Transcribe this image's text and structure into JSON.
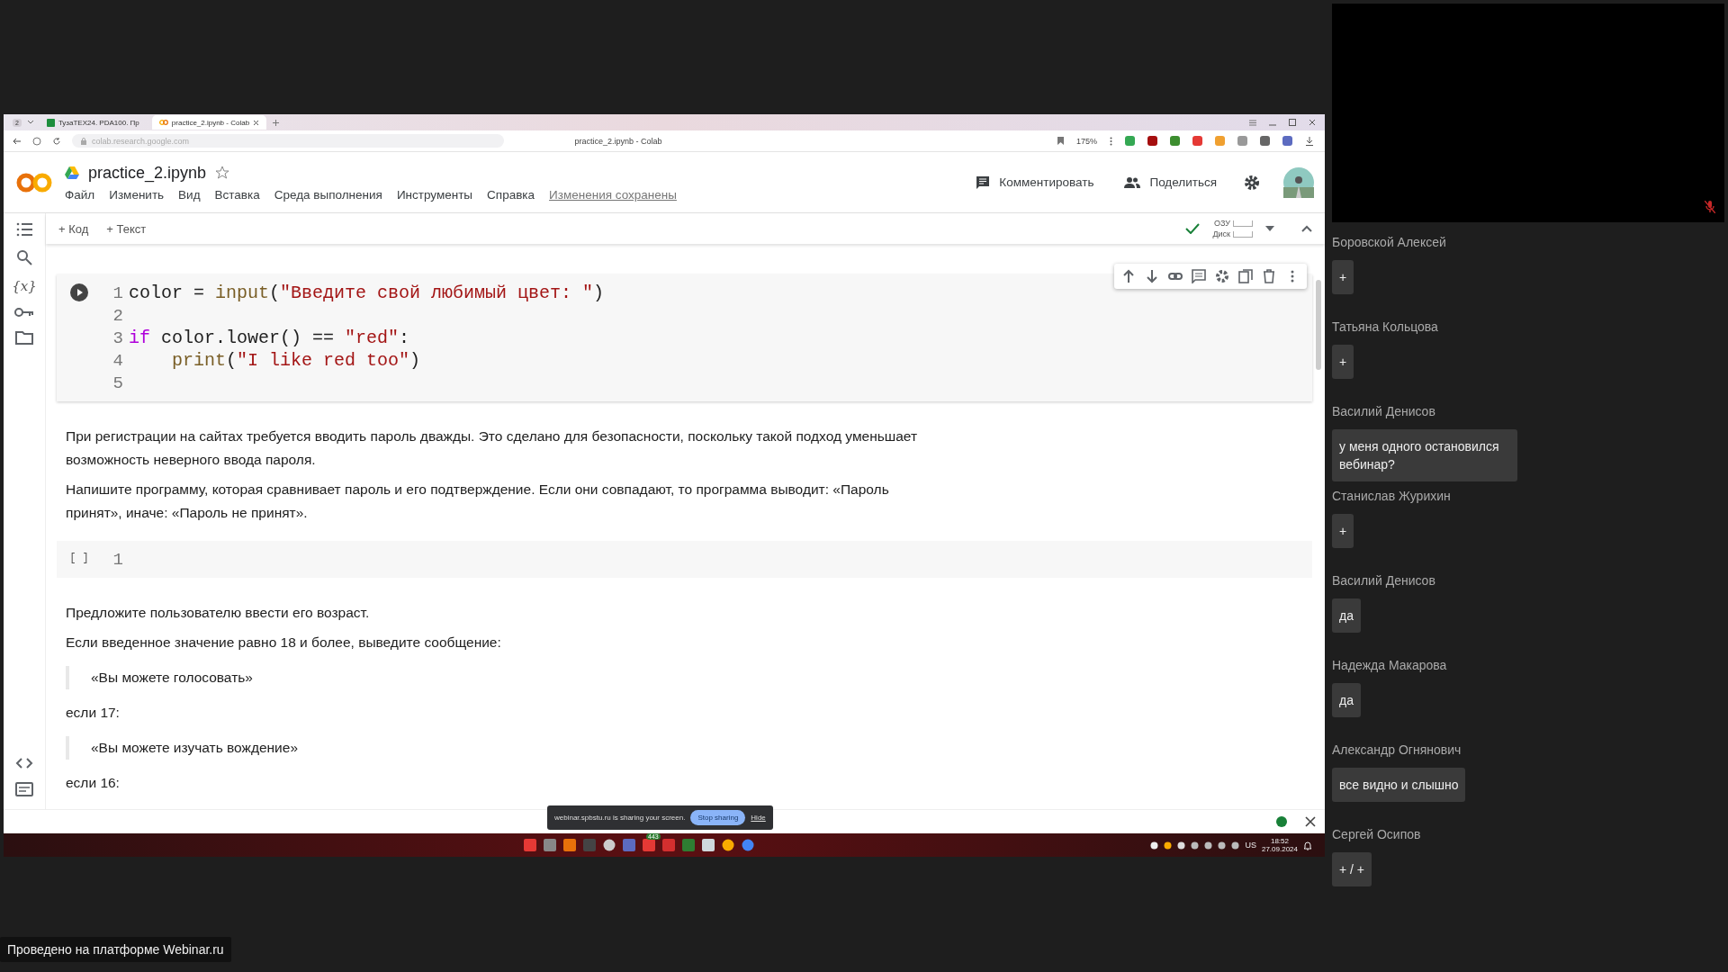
{
  "browser": {
    "tab_count": "2",
    "tabs": [
      {
        "label": "TyзaTEX24. PDA100. Пр",
        "selected": false
      },
      {
        "label": "practice_2.ipynb - Colab",
        "selected": true
      }
    ],
    "url": "colab.research.google.com",
    "page_title": "practice_2.ipynb - Colab",
    "zoom": "175%"
  },
  "colab": {
    "file_name": "practice_2.ipynb",
    "menu": [
      "Файл",
      "Изменить",
      "Вид",
      "Вставка",
      "Среда выполнения",
      "Инструменты",
      "Справка"
    ],
    "save_status": "Изменения сохранены",
    "comment": "Комментировать",
    "share": "Поделиться",
    "toolbar": [
      "+ Код",
      "+ Текст"
    ],
    "resources": [
      "ОЗУ",
      "Диск"
    ],
    "variables_label": "{x}",
    "cells": [
      {
        "kind": "code",
        "focused": true,
        "lines": [
          {
            "number": "1",
            "tokens": [
              {
                "kind": "plain",
                "text": "color = "
              },
              {
                "kind": "func",
                "text": "input"
              },
              {
                "kind": "plain",
                "text": "("
              },
              {
                "kind": "string",
                "text": "\"Введите свой любимый цвет: \""
              },
              {
                "kind": "plain",
                "text": ")"
              }
            ]
          },
          {
            "number": "2"
          },
          {
            "number": "3",
            "tokens": [
              {
                "kind": "keyword",
                "text": "if"
              },
              {
                "kind": "plain",
                "text": " color.lower() == "
              },
              {
                "kind": "string",
                "text": "\"red\""
              },
              {
                "kind": "plain",
                "text": ":"
              }
            ]
          },
          {
            "number": "4",
            "indented": true,
            "tokens": [
              {
                "kind": "func",
                "text": "print"
              },
              {
                "kind": "plain",
                "text": "("
              },
              {
                "kind": "string",
                "text": "\"I like red too\""
              },
              {
                "kind": "plain",
                "text": ")"
              }
            ]
          },
          {
            "number": "5"
          }
        ]
      },
      {
        "kind": "text",
        "blocks": [
          {
            "kind": "p",
            "text": "При регистрации на сайтах требуется вводить пароль дважды. Это сделано для безопасности, поскольку такой подход уменьшает возможность неверного ввода пароля."
          },
          {
            "kind": "p",
            "text": "Напишите программу, которая сравнивает пароль и его подтверждение. Если они совпадают, то программа выводит: «Пароль принят», иначе: «Пароль не принят»."
          }
        ]
      },
      {
        "kind": "code",
        "focused": false,
        "prompt": "[ ]",
        "lines": [
          {
            "number": "1"
          }
        ]
      },
      {
        "kind": "text",
        "blocks": [
          {
            "kind": "p",
            "text": "Предложите пользователю ввести его возраст."
          },
          {
            "kind": "p",
            "text": "Если введенное значение равно 18 и более, выведите сообщение:"
          },
          {
            "kind": "quote",
            "text": "«Вы можете голосовать»"
          },
          {
            "kind": "p",
            "text": "если 17:"
          },
          {
            "kind": "quote",
            "text": "«Вы можете изучать вождение»"
          },
          {
            "kind": "p",
            "text": "если 16:"
          }
        ]
      }
    ]
  },
  "sharing_bar": {
    "message": "webinar.spbstu.ru is sharing your screen.",
    "stop": "Stop sharing",
    "hide": "Hide"
  },
  "taskbar": {
    "badge": "443",
    "language": "US",
    "time": "18:52",
    "date": "27.09.2024"
  },
  "chat": [
    {
      "author": "Боровской Алексей",
      "message": "+"
    },
    {
      "author": "Татьяна Кольцова",
      "message": "+"
    },
    {
      "author": "Василий Денисов",
      "message": "у меня одного остановился вебинар?"
    },
    {
      "author": "Станислав Журихин",
      "message": "+"
    },
    {
      "author": "Василий Денисов",
      "message": "да"
    },
    {
      "author": "Надежда Макарова",
      "message": "да"
    },
    {
      "author": "Александр Огнянович",
      "message": "все видно и слышно"
    },
    {
      "author": "Сергей Осипов",
      "message": "+ / +"
    }
  ],
  "footer": "Проведено на платформе Webinar.ru"
}
